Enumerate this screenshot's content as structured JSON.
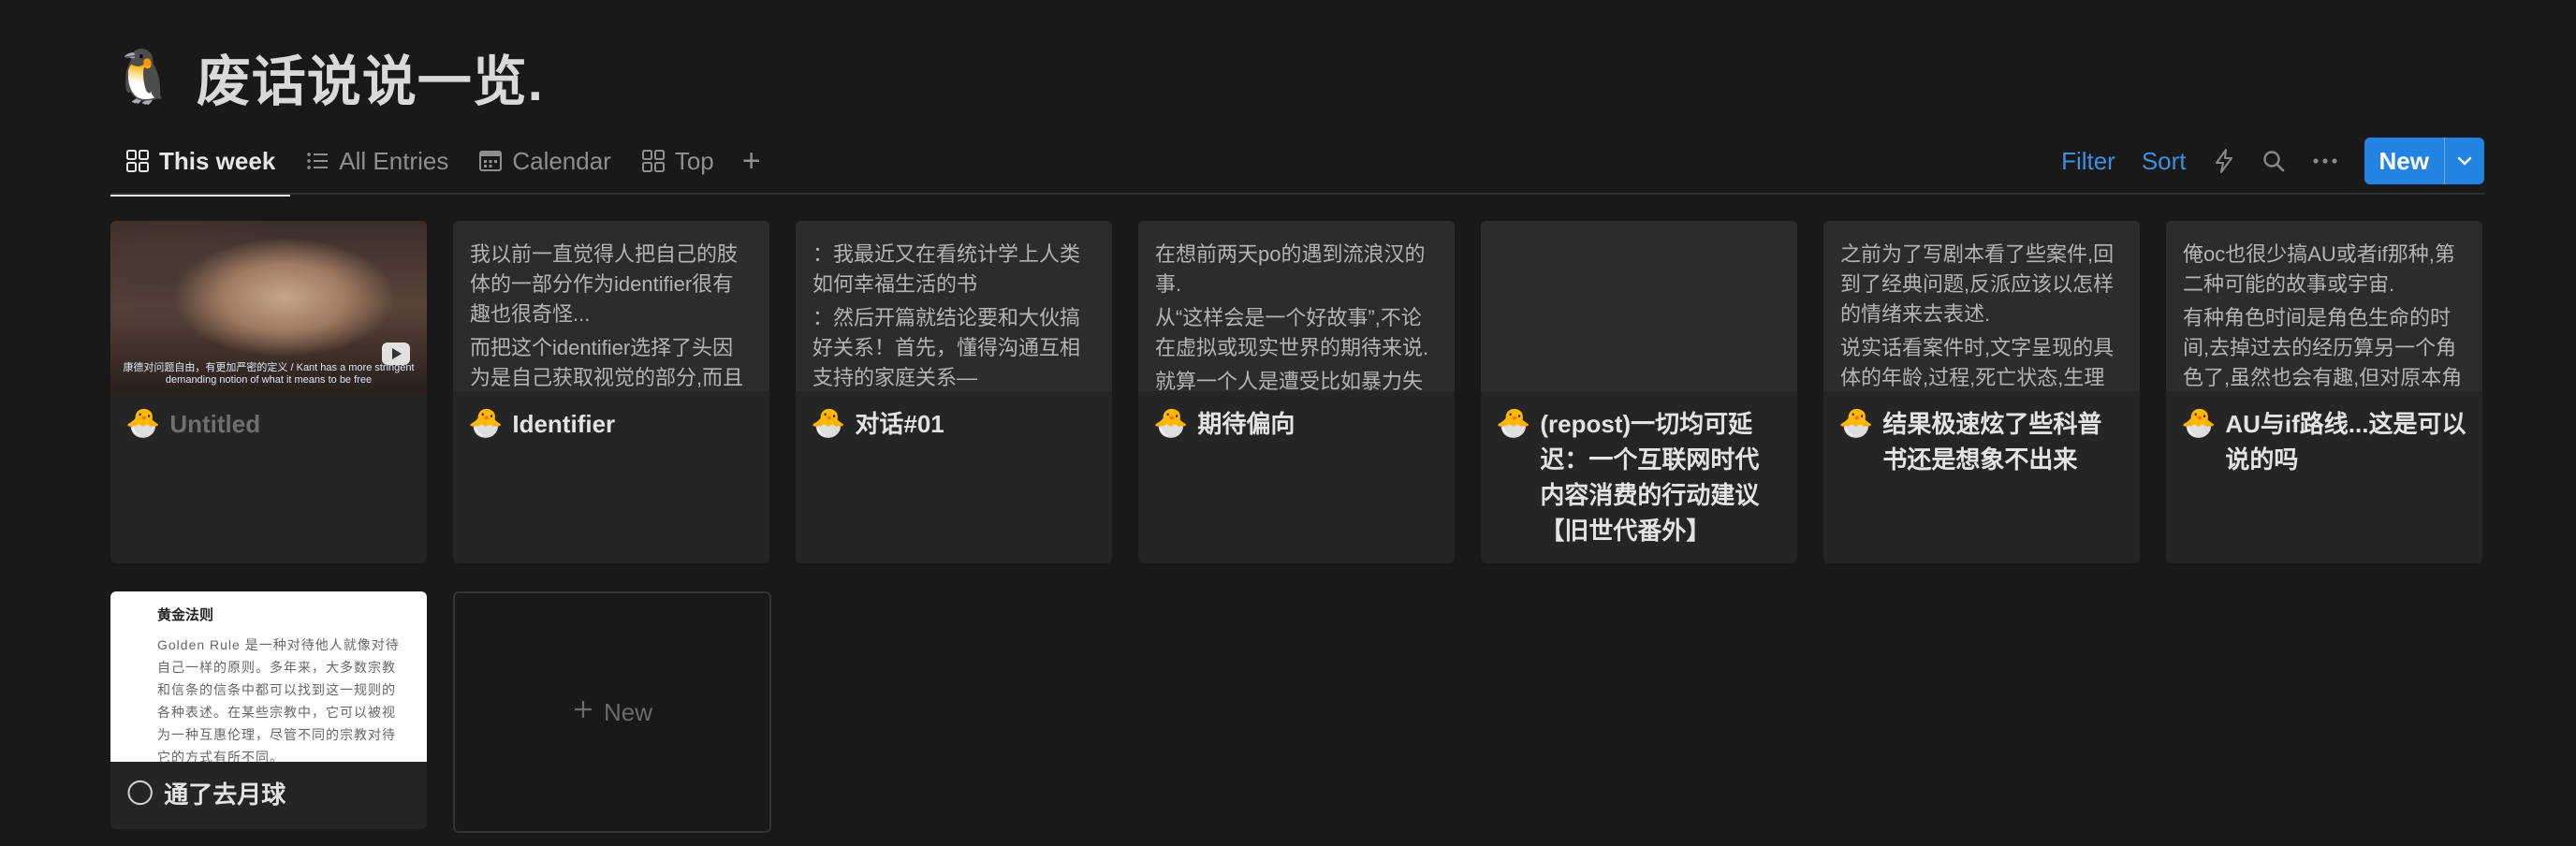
{
  "page": {
    "icon": "🐧",
    "title": "废话说说一览."
  },
  "tabs": [
    {
      "label": "This week",
      "icon": "gallery-icon",
      "active": true
    },
    {
      "label": "All Entries",
      "icon": "list-icon",
      "active": false
    },
    {
      "label": "Calendar",
      "icon": "calendar-icon",
      "active": false
    },
    {
      "label": "Top",
      "icon": "gallery-icon",
      "active": false
    }
  ],
  "toolbar": {
    "filter_label": "Filter",
    "sort_label": "Sort",
    "new_label": "New"
  },
  "cards": [
    {
      "preview_type": "image",
      "image_caption": "康德对问题自由，有更加严密的定义 / Kant has a more stringent demanding notion of what it means to be free",
      "emoji": "🐣",
      "title": "Untitled"
    },
    {
      "preview_type": "text",
      "preview": [
        "我以前一直觉得人把自己的肢体的一部分作为identifier很有趣也很奇怪...",
        "而把这个identifier选择了头因为是自己获取视觉的部分,而且"
      ],
      "emoji": "🐣",
      "title": "Identifier"
    },
    {
      "preview_type": "text",
      "preview": [
        "：我最近又在看统计学上人类如何幸福生活的书",
        "：然后开篇就结论要和大伙搞好关系！首先，懂得沟通互相支持的家庭关系—"
      ],
      "emoji": "🐣",
      "title": "对话#01"
    },
    {
      "preview_type": "text",
      "preview": [
        "在想前两天po的遇到流浪汉的事.",
        "从“这样会是一个好故事”,不论在虚拟或现实世界的期待来说.",
        "就算一个人是遭受比如暴力失"
      ],
      "emoji": "🐣",
      "title": "期待偏向"
    },
    {
      "preview_type": "empty",
      "preview": [],
      "emoji": "🐣",
      "title": "(repost)一切均可延迟：一个互联网时代内容消费的行动建议【旧世代番外】"
    },
    {
      "preview_type": "text",
      "preview": [
        "之前为了写剧本看了些案件,回到了经典问题,反派应该以怎样的情绪来去表述.",
        "说实话看案件时,文字呈现的具体的年龄,过程,死亡状态,生理上"
      ],
      "emoji": "🐣",
      "title": "结果极速炫了些科普书还是想象不出来"
    },
    {
      "preview_type": "text",
      "preview": [
        "俺oc也很少搞AU或者if那种,第二种可能的故事或宇宙.",
        "有种角色时间是角色生命的时间,去掉过去的经历算另一个角色了,虽然也会有趣,但对原本角"
      ],
      "emoji": "🐣",
      "title": "AU与if路线...这是可以说的吗"
    },
    {
      "preview_type": "document",
      "doc_heading": "黄金法则",
      "doc_text": "Golden Rule 是一种对待他人就像对待自己一样的原则。多年来，大多数宗教和信条的信条中都可以找到这一规则的各种表述。在某些宗教中，它可以被视为一种互惠伦理，尽管不同的宗教对待它的方式有所不同。",
      "emoji": "🌕",
      "title": "通了去月球"
    }
  ],
  "new_card": {
    "label": "New"
  }
}
